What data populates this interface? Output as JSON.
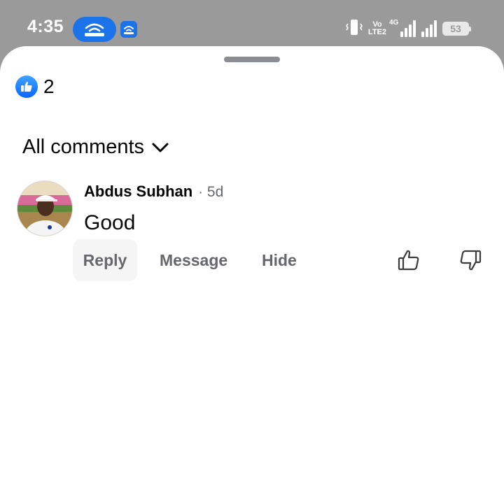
{
  "status_bar": {
    "time": "4:35",
    "network_line1": "Vo",
    "network_line2": "LTE2",
    "network_type": "4G",
    "battery": "53",
    "icons": [
      "hotspot-icon",
      "hotspot-small-icon",
      "vibrate-icon",
      "signal-icon",
      "battery-icon"
    ]
  },
  "reactions": {
    "icon": "like-icon",
    "count": "2"
  },
  "filter": {
    "label": "All comments",
    "icon": "chevron-down-icon"
  },
  "comment": {
    "author": "Abdus Subhan",
    "separator": "·",
    "time": "5d",
    "text": "Good",
    "actions": {
      "reply": "Reply",
      "message": "Message",
      "hide": "Hide"
    },
    "vote_icons": [
      "thumbs-up-icon",
      "thumbs-down-icon"
    ]
  },
  "colors": {
    "accent": "#1a73e8",
    "like_blue": "#0866ff",
    "secondary_text": "#65676b",
    "primary_text": "#050505"
  }
}
